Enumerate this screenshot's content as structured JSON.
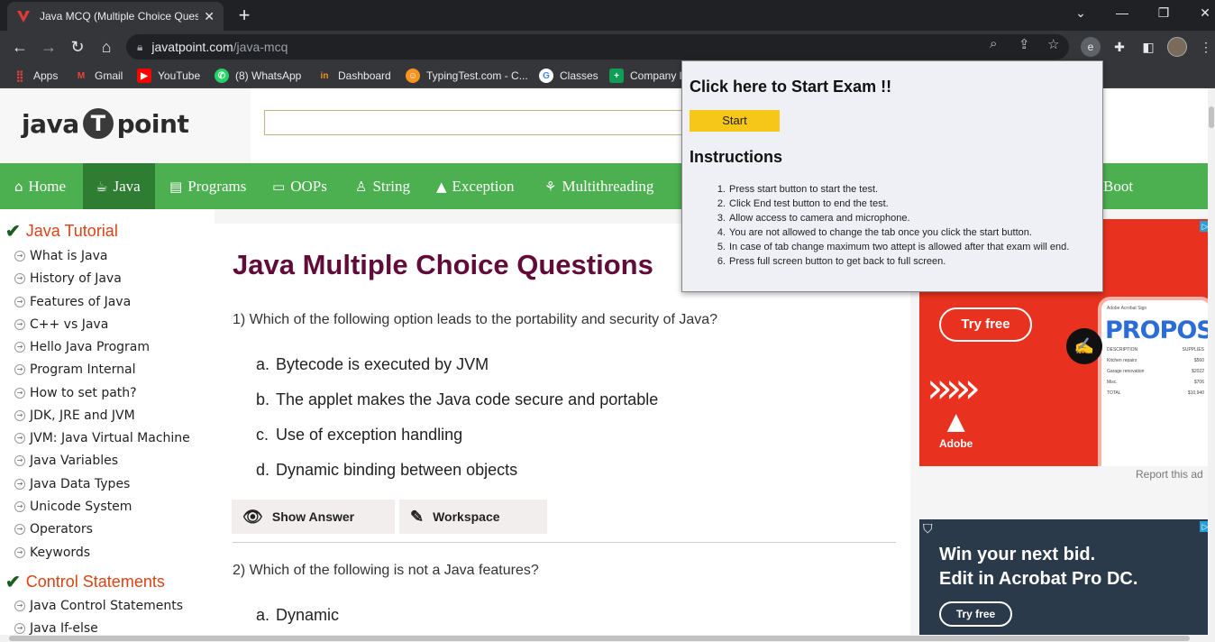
{
  "browser": {
    "tab_title": "Java MCQ (Multiple Choice Ques",
    "url_host": "javatpoint.com",
    "url_path": "/java-mcq",
    "ext_label": "e"
  },
  "bookmarks": [
    {
      "label": "Apps",
      "color": "#e8eaed"
    },
    {
      "label": "Gmail",
      "color": "#ea4335"
    },
    {
      "label": "YouTube",
      "color": "#ff0000"
    },
    {
      "label": "(8) WhatsApp",
      "color": "#25d366"
    },
    {
      "label": "Dashboard",
      "color": "#f29111"
    },
    {
      "label": "TypingTest.com - C...",
      "color": "#f7931e"
    },
    {
      "label": "Classes",
      "color": "#4285f4"
    },
    {
      "label": "Company l",
      "color": "#0f9d58"
    }
  ],
  "site": {
    "logo_left": "java",
    "logo_mid": "T",
    "logo_right": "point",
    "menu": [
      {
        "label": "Home",
        "icon": "⌂"
      },
      {
        "label": "Java",
        "icon": "☕"
      },
      {
        "label": "Programs",
        "icon": "▤"
      },
      {
        "label": "OOPs",
        "icon": "▭"
      },
      {
        "label": "String",
        "icon": "♙"
      },
      {
        "label": "Exception",
        "icon": "▲"
      },
      {
        "label": "Multithreading",
        "icon": "⚘"
      },
      {
        "label": "Boot",
        "icon": ""
      }
    ]
  },
  "sidebar": {
    "sections": [
      {
        "title": "Java Tutorial"
      },
      {
        "title": "Control Statements"
      }
    ],
    "items": [
      "What is Java",
      "History of Java",
      "Features of Java",
      "C++ vs Java",
      "Hello Java Program",
      "Program Internal",
      "How to set path?",
      "JDK, JRE and JVM",
      "JVM: Java Virtual Machine",
      "Java Variables",
      "Java Data Types",
      "Unicode System",
      "Operators",
      "Keywords"
    ],
    "items2": [
      "Java Control Statements",
      "Java If-else"
    ]
  },
  "main": {
    "title": "Java Multiple Choice Questions",
    "q1": {
      "text": "1) Which of the following option leads to the portability and security of Java?",
      "options": [
        {
          "letter": "a.",
          "text": "Bytecode is executed by JVM"
        },
        {
          "letter": "b.",
          "text": "The applet makes the Java code secure and portable"
        },
        {
          "letter": "c.",
          "text": "Use of exception handling"
        },
        {
          "letter": "d.",
          "text": "Dynamic binding between objects"
        }
      ]
    },
    "show_answer": "Show Answer",
    "workspace": "Workspace",
    "q2": {
      "text": "2) Which of the following is not a Java features?",
      "options": [
        {
          "letter": "a.",
          "text": "Dynamic"
        }
      ]
    }
  },
  "ads": {
    "ad1_try": "Try free",
    "ad1_brand": "Adobe",
    "ad1_phone_header": "Adobe Acrobat Sign",
    "ad1_phone_title": "PROPOSAL",
    "ad1_phone_rows": [
      {
        "k": "DESCRIPTION",
        "v": "SUPPLIES"
      },
      {
        "k": "Kitchen repairs",
        "v": "$560"
      },
      {
        "k": "Garage renovation",
        "v": "$2022"
      },
      {
        "k": "Misc.",
        "v": "$706"
      },
      {
        "k": "TOTAL",
        "v": "$10,940"
      }
    ],
    "report": "Report this ad",
    "ad2_line1": "Win your next bid.",
    "ad2_line2": "Edit in Acrobat Pro DC.",
    "ad2_try": "Try free"
  },
  "popup": {
    "title": "Click here to Start Exam !!",
    "start": "Start",
    "instructions_title": "Instructions",
    "instructions": [
      "Press start button to start the test.",
      "Click End test button to end the test.",
      "Allow access to camera and microphone.",
      "You are not allowed to change the tab once you click the start button.",
      "In case of tab change maximum two attept is allowed after that exam will end.",
      "Press full screen button to get back to full screen."
    ]
  }
}
